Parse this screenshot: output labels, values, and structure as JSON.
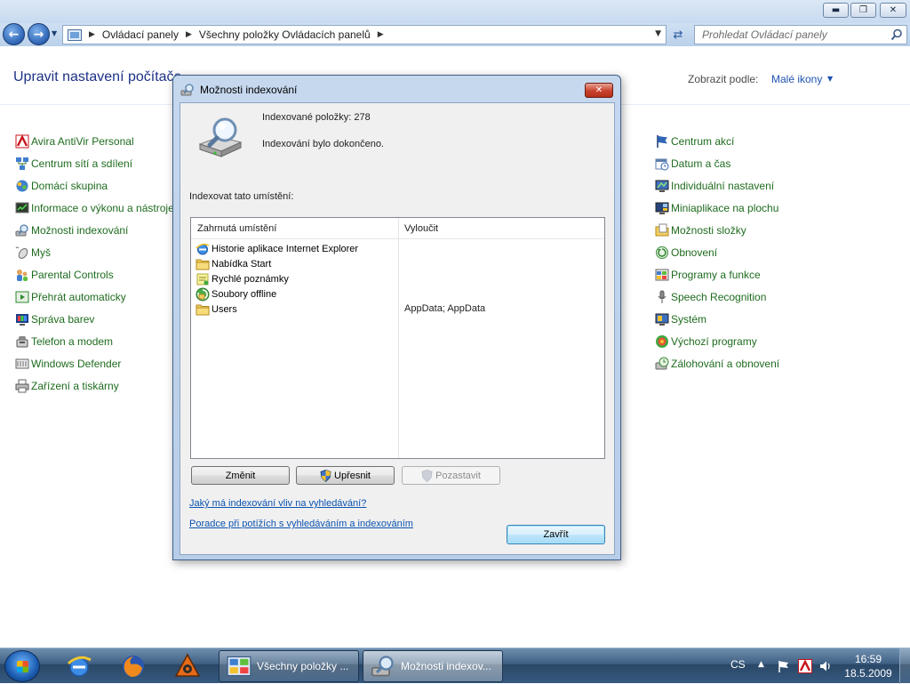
{
  "explorer": {
    "breadcrumb": [
      "Ovládací panely",
      "Všechny položky Ovládacích panelů"
    ],
    "search_placeholder": "Prohledat Ovládací panely",
    "title": "Upravit nastavení počítače",
    "view_by_label": "Zobrazit podle:",
    "view_by_value": "Malé ikony",
    "column1": [
      {
        "label": "Avira AntiVir Personal",
        "icon": "avira-icon"
      },
      {
        "label": "Centrum sítí a sdílení",
        "icon": "network-icon"
      },
      {
        "label": "Domácí skupina",
        "icon": "homegroup-icon"
      },
      {
        "label": "Informace o výkonu a nástroje",
        "icon": "performance-icon"
      },
      {
        "label": "Možnosti indexování",
        "icon": "indexing-icon"
      },
      {
        "label": "Myš",
        "icon": "mouse-icon"
      },
      {
        "label": "Parental Controls",
        "icon": "parental-controls-icon"
      },
      {
        "label": "Přehrát automaticky",
        "icon": "autoplay-icon"
      },
      {
        "label": "Správa barev",
        "icon": "color-management-icon"
      },
      {
        "label": "Telefon a modem",
        "icon": "phone-modem-icon"
      },
      {
        "label": "Windows Defender",
        "icon": "defender-icon"
      },
      {
        "label": "Zařízení a tiskárny",
        "icon": "printer-icon"
      }
    ],
    "column3": [
      {
        "label": "Centrum akcí",
        "icon": "action-center-flag-icon"
      },
      {
        "label": "Datum a čas",
        "icon": "clock-icon"
      },
      {
        "label": "Individuální nastavení",
        "icon": "personalization-icon"
      },
      {
        "label": "Miniaplikace na plochu",
        "icon": "gadgets-icon"
      },
      {
        "label": "Možnosti složky",
        "icon": "folder-options-icon"
      },
      {
        "label": "Obnovení",
        "icon": "recovery-icon"
      },
      {
        "label": "Programy a funkce",
        "icon": "programs-icon"
      },
      {
        "label": "Speech Recognition",
        "icon": "microphone-icon"
      },
      {
        "label": "Systém",
        "icon": "system-icon"
      },
      {
        "label": "Výchozí programy",
        "icon": "default-programs-icon"
      },
      {
        "label": "Zálohování a obnovení",
        "icon": "backup-icon"
      }
    ]
  },
  "dialog": {
    "title": "Možnosti indexování",
    "indexed_count": "Indexované položky: 278",
    "status": "Indexování bylo dokončeno.",
    "locations_label": "Indexovat tato umístění:",
    "columns": {
      "included": "Zahrnutá umístění",
      "exclude": "Vyloučit"
    },
    "locations": [
      {
        "name": "Historie aplikace Internet Explorer",
        "icon": "ie-icon",
        "exclude": ""
      },
      {
        "name": "Nabídka Start",
        "icon": "folder-icon",
        "exclude": ""
      },
      {
        "name": "Rychlé poznámky",
        "icon": "notes-icon",
        "exclude": ""
      },
      {
        "name": "Soubory offline",
        "icon": "offline-files-icon",
        "exclude": ""
      },
      {
        "name": "Users",
        "icon": "folder-icon",
        "exclude": "AppData; AppData"
      }
    ],
    "buttons": {
      "change": "Změnit",
      "advanced": "Upřesnit",
      "pause": "Pozastavit",
      "close": "Zavřít"
    },
    "links": {
      "impact": "Jaký má indexování vliv na vyhledávání?",
      "troubleshoot": "Poradce při potížích s vyhledáváním a indexováním"
    }
  },
  "taskbar": {
    "tasks": [
      {
        "label": "Všechny položky ...",
        "icon": "control-panel-icon"
      },
      {
        "label": "Možnosti indexov...",
        "icon": "indexing-icon"
      }
    ],
    "language": "CS",
    "time": "16:59",
    "date": "18.5.2009"
  },
  "colors": {
    "link": "#0c54b0",
    "cp_item": "#1e6b1e",
    "title": "#1e3287"
  }
}
